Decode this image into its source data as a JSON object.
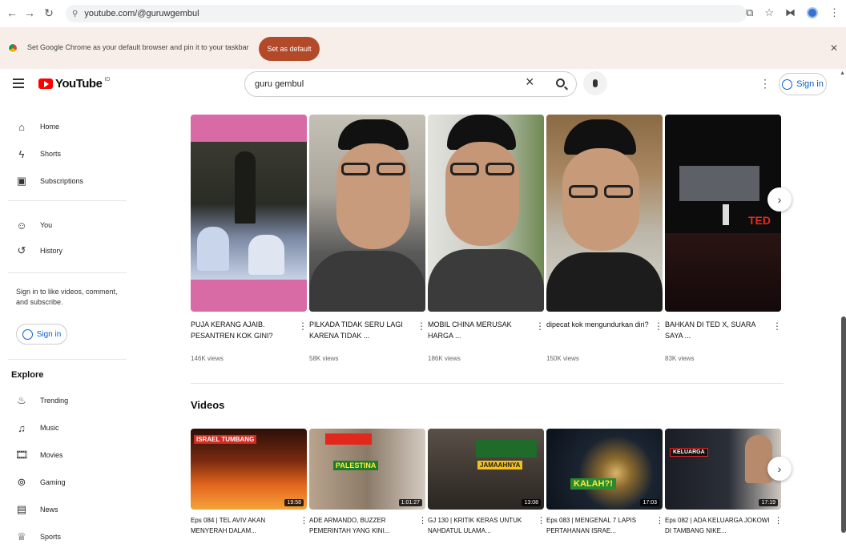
{
  "browser": {
    "url": "youtube.com/@guruwgembul",
    "infobar_text": "Set Google Chrome as your default browser and pin it to your taskbar",
    "set_default_label": "Set as default"
  },
  "header": {
    "logo_text": "YouTube",
    "country_code": "ID",
    "search_value": "guru gembul",
    "signin_label": "Sign in"
  },
  "sidebar": {
    "items": [
      {
        "label": "Home",
        "icon": "home-icon"
      },
      {
        "label": "Shorts",
        "icon": "shorts-icon"
      },
      {
        "label": "Subscriptions",
        "icon": "subscriptions-icon"
      },
      {
        "label": "You",
        "icon": "you-icon"
      },
      {
        "label": "History",
        "icon": "history-icon"
      }
    ],
    "signin_prompt": "Sign in to like videos, comment, and subscribe.",
    "signin_label": "Sign in",
    "explore_heading": "Explore",
    "explore_items": [
      {
        "label": "Trending",
        "icon": "trending-icon"
      },
      {
        "label": "Music",
        "icon": "music-icon"
      },
      {
        "label": "Movies",
        "icon": "movies-icon"
      },
      {
        "label": "Gaming",
        "icon": "gaming-icon"
      },
      {
        "label": "News",
        "icon": "news-icon"
      },
      {
        "label": "Sports",
        "icon": "sports-icon"
      }
    ]
  },
  "shorts": [
    {
      "title": "PUJA KERANG AJAIB. PESANTREN KOK GINI?",
      "views": "146K views"
    },
    {
      "title": "PILKADA TIDAK SERU LAGI KARENA TIDAK ...",
      "views": "58K views"
    },
    {
      "title": "MOBIL CHINA MERUSAK HARGA ...",
      "views": "186K views"
    },
    {
      "title": "dipecat kok mengundurkan diri?",
      "views": "150K views"
    },
    {
      "title": "BAHKAN DI TED X, SUARA SAYA ...",
      "views": "83K views"
    }
  ],
  "videos_heading": "Videos",
  "videos": [
    {
      "title": "Eps 084 | TEL AVIV AKAN MENYERAH DALAM...",
      "duration": "19:58",
      "thumb_text": "ISRAEL TUMBANG"
    },
    {
      "title": "ADE ARMANDO, BUZZER PEMERINTAH YANG KINI...",
      "duration": "1:01:27",
      "thumb_text": "PALESTINA"
    },
    {
      "title": "GJ 130 | KRITIK KERAS UNTUK NAHDATUL ULAMA...",
      "duration": "13:08",
      "thumb_text": "JAMAAHNYA"
    },
    {
      "title": "Eps 083 | MENGENAL 7 LAPIS PERTAHANAN ISRAE...",
      "duration": "17:03",
      "thumb_text": "KALAH?!"
    },
    {
      "title": "Eps 082 | ADA KELUARGA JOKOWI DI TAMBANG NIKE...",
      "duration": "17:19",
      "thumb_text": "KELUARGA"
    }
  ]
}
